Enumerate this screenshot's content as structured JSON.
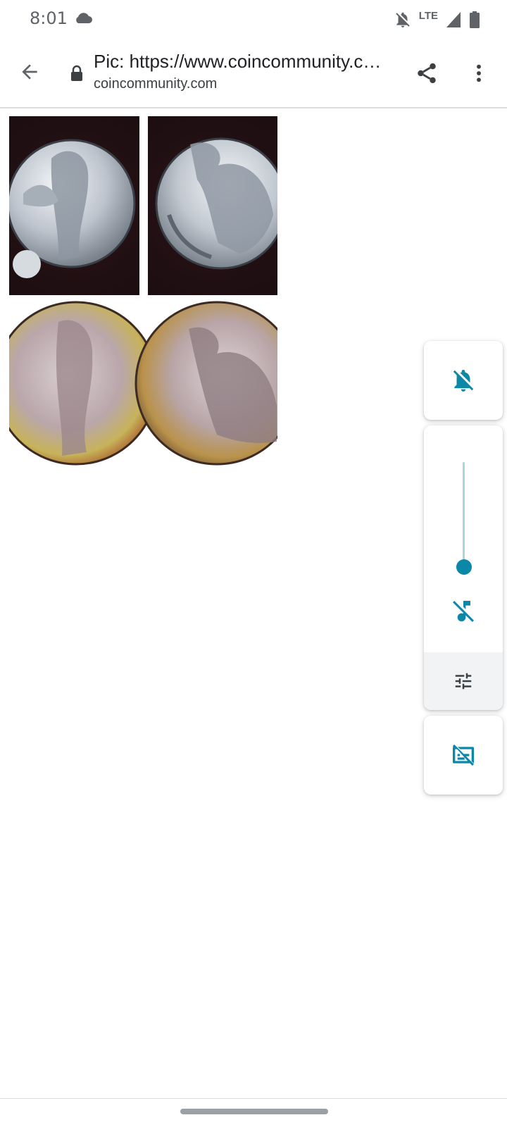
{
  "status_bar": {
    "time": "8:01",
    "network_label": "LTE",
    "icons": [
      "cloud-icon",
      "notifications-off-icon",
      "signal-icon",
      "battery-icon"
    ]
  },
  "toolbar": {
    "title": "Pic: https://www.coincommunity.com/forum/topic.asp?TOPIC_ID=...",
    "domain": "coincommunity.com",
    "icons": [
      "back-arrow-icon",
      "lock-icon",
      "share-icon",
      "more-vert-icon"
    ]
  },
  "content": {
    "image_description_icons": [
      "coin-obverse-image",
      "coin-reverse-image",
      "coin-pair-toned-image"
    ]
  },
  "volume_panel": {
    "accent_color": "#0b87a8",
    "media_volume_level": 0.0,
    "icons": [
      "ringer-off-icon",
      "music-off-icon",
      "tune-icon",
      "captions-off-icon"
    ]
  }
}
